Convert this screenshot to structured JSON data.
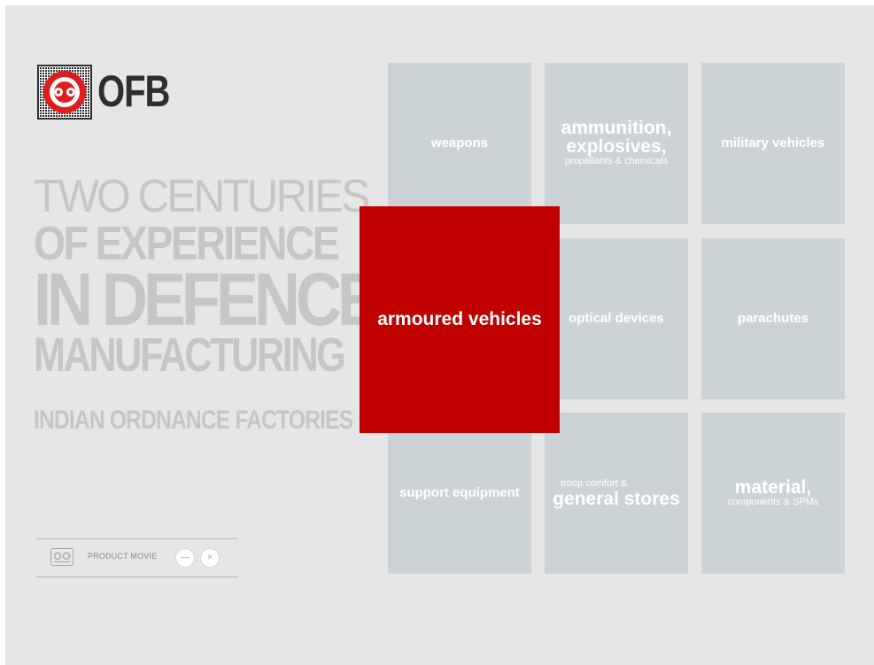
{
  "logo": {
    "text": "OFB",
    "icon": "ofb-target-emblem"
  },
  "headline": {
    "line1": "TWO CENTURIES",
    "line2": "OF EXPERIENCE",
    "line3": "IN DEFENCE",
    "line4": "MANUFACTURING",
    "subtitle": "INDIAN ORDNANCE FACTORIES"
  },
  "movie_bar": {
    "icon": "film-reel-icon",
    "label": "PRODUCT MOVIE",
    "minimize_symbol": "—",
    "close_symbol": "×"
  },
  "tiles": {
    "weapons": "weapons",
    "ammunition_big": "ammunition,\nexplosives,",
    "ammunition_small": "propellants & chemicals",
    "military_vehicles": "military vehicles",
    "armoured_vehicles": "armoured vehicles",
    "optical_devices": "optical devices",
    "parachutes": "parachutes",
    "support_equipment": "support equipment",
    "troop_small": "troop comfort &",
    "troop_big": "general stores",
    "material_big": "material,",
    "material_small": "components & SPMs"
  },
  "colors": {
    "background": "#e6e6e6",
    "tile": "#ccd3d6",
    "highlight_tile": "#c00000",
    "headline_text": "#c6c6c6"
  }
}
